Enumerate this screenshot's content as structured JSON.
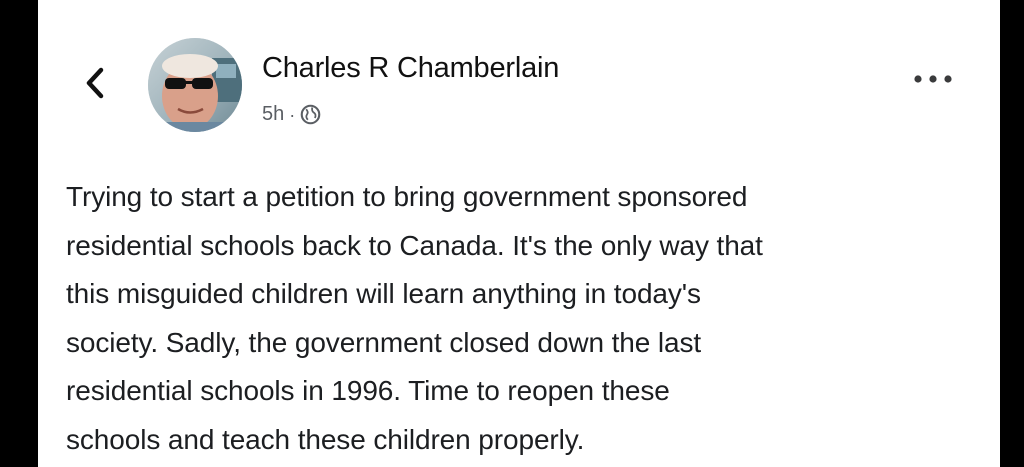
{
  "post": {
    "author_name": "Charles R Chamberlain",
    "timestamp": "5h",
    "separator": "·",
    "audience_icon": "globe-icon",
    "more_icon": "more-options-icon",
    "back_icon": "chevron-left-icon",
    "text_lines": [
      "Trying to start a petition to bring government sponsored",
      "residential schools back to Canada. It's the only way that",
      "this misguided children will learn anything in today's",
      "society. Sadly, the government closed down the last",
      "residential schools in 1996. Time to reopen these",
      "schools and teach these children properly."
    ]
  },
  "colors": {
    "background": "#000000",
    "card": "#ffffff",
    "text": "#1c1e21",
    "meta": "#5a5e63"
  }
}
